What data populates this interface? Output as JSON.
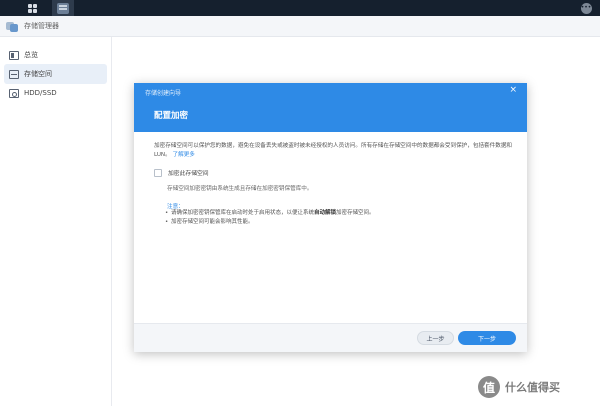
{
  "app": {
    "title": "存储管理器"
  },
  "sidebar": {
    "items": [
      {
        "label": "总览",
        "icon": "overview-icon",
        "active": false
      },
      {
        "label": "存储空间",
        "icon": "storage-icon",
        "active": true
      },
      {
        "label": "HDD/SSD",
        "icon": "hdd-icon",
        "active": false
      }
    ]
  },
  "dialog": {
    "window_title": "存储创建向导",
    "close_symbol": "×",
    "heading": "配置加密",
    "description": "加密存储空间可以保护您的数据，避免在设备丢失或被盗时被未经授权的人员访问。所有存储在存储空间中的数据都会受到保护，包括套件数据和 LUN。",
    "learn_more": "了解更多",
    "checkbox_label": "加密此存储空间",
    "checkbox_checked": false,
    "sub_description": "存储空间加密密钥由系统生成且存储在加密密钥保管库中。",
    "note_title": "注意：",
    "notes": {
      "first_before": "请确保加密密钥保管库在启动时处于启用状态，以便让系统",
      "first_bold": "自动解锁",
      "first_after": "加密存储空间。",
      "second": "加密存储空间可能会影响其性能。"
    },
    "buttons": {
      "prev": "上一步",
      "next": "下一步"
    }
  },
  "watermark": {
    "icon_char": "值",
    "text": "什么值得买"
  },
  "colors": {
    "accent": "#2e8ae6",
    "taskbar": "#15202e"
  }
}
